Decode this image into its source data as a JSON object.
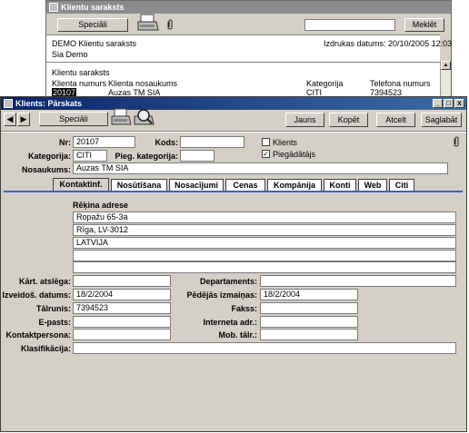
{
  "list_window": {
    "title": "Klientu saraksts",
    "special_button": "Speciāli",
    "search_button": "Meklēt",
    "company": "DEMO Klientu saraksts",
    "company2": "Sia Demo",
    "print_date": "Izdrukas datums: 20/10/2005 12:03",
    "report_title": "Klientu saraksts",
    "columns": [
      "Klienta numurs",
      "Klienta nosaukums",
      "Kategorija",
      "Telefona numurs"
    ],
    "row": {
      "number": "20107",
      "name": "Auzas TM SIA",
      "category": "CITI",
      "phone": "7394523"
    }
  },
  "detail_window": {
    "title": "Klients: Pārskats",
    "special_button": "Speciāli",
    "new_button": "Jauns",
    "copy_button": "Kopēt",
    "cancel_button": "Atcelt",
    "save_button": "Saglabāt",
    "labels": {
      "nr": "Nr:",
      "kods": "Kods:",
      "kategorija": "Kategorija:",
      "pieg_kategorija": "Pieg. kategorija:",
      "nosaukums": "Nosaukums:",
      "klients": "Klients",
      "piegadatajs": "Piegādātājs"
    },
    "values": {
      "nr": "20107",
      "kods": "",
      "kategorija": "CITI",
      "pieg_kategorija": "",
      "nosaukums": "Auzas TM SIA"
    },
    "checkboxes": {
      "klients": false,
      "piegadatajs": true
    },
    "tabs": [
      "Kontaktinf.",
      "Nosūtīšana",
      "Nosacījumi",
      "Cenas",
      "Kompānija",
      "Konti",
      "Web",
      "Citi"
    ],
    "active_tab": "Kontaktinf.",
    "invoice_address_label": "Rēķina adrese",
    "address_lines": [
      "Ropažu 65-3a",
      "Rīga, LV-3012",
      "LATVIJA",
      "",
      ""
    ],
    "contact_labels": {
      "kart_atslega": "Kārt. atslēga:",
      "departaments": "Departaments:",
      "izveidots": "Izveidoš. datums:",
      "pedejas_izmainas": "Pēdējās izmaiņas:",
      "talrunis": "Tālrunis:",
      "fakss": "Fakss:",
      "epasts": "E-pasts:",
      "interneta": "Interneta adr.:",
      "kontaktpersona": "Kontaktpersona:",
      "mob": "Mob. tālr.:",
      "klasifikacija": "Klasifikācija:"
    },
    "contact_values": {
      "kart_atslega": "",
      "departaments": "",
      "izveidots": "18/2/2004",
      "pedejas_izmainas": "18/2/2004",
      "talrunis": "7394523",
      "fakss": "",
      "epasts": "",
      "interneta": "",
      "kontaktpersona": "",
      "mob": "",
      "klasifikacija": ""
    }
  }
}
